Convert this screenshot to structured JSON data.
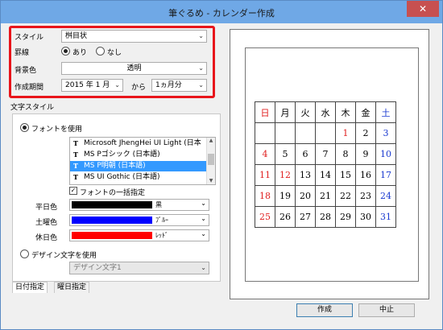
{
  "window": {
    "title": "筆ぐるめ - カレンダー作成",
    "close_symbol": "✕"
  },
  "settings": {
    "style_label": "スタイル",
    "style_value": "桝目状",
    "border_label": "罫線",
    "border_on": "あり",
    "border_off": "なし",
    "bg_label": "背景色",
    "bg_value": "透明",
    "period_label": "作成期間",
    "period_start": "2015 年 1 月",
    "period_connector": "から",
    "period_length": "1ヵ月分"
  },
  "text_style": {
    "section_title": "文字スタイル",
    "use_font_label": "フォントを使用",
    "fonts": [
      "Microsoft JhengHei UI Light (日本",
      "MS Pゴシック (日本語)",
      "MS P明朝 (日本語)",
      "MS UI Gothic (日本語)"
    ],
    "tt_symbol": "T",
    "bulk_label": "フォントの一括指定",
    "weekday_label": "平日色",
    "weekday_color_name": "黒",
    "weekday_color": "#000000",
    "saturday_label": "土曜色",
    "saturday_color_name": "ﾌﾞﾙｰ",
    "saturday_color": "#0000ff",
    "holiday_label": "休日色",
    "holiday_color_name": "ﾚｯﾄﾞ",
    "holiday_color": "#ff0000",
    "design_label": "デザイン文字を使用",
    "design_value": "デザイン文字1"
  },
  "tabs": [
    "日付指定",
    "曜日指定"
  ],
  "calendar": {
    "header": [
      "日",
      "月",
      "火",
      "水",
      "木",
      "金",
      "土"
    ],
    "rows": [
      [
        "",
        "",
        "",
        "",
        "1",
        "2",
        "3"
      ],
      [
        "4",
        "5",
        "6",
        "7",
        "8",
        "9",
        "10"
      ],
      [
        "11",
        "12",
        "13",
        "14",
        "15",
        "16",
        "17"
      ],
      [
        "18",
        "19",
        "20",
        "21",
        "22",
        "23",
        "24"
      ],
      [
        "25",
        "26",
        "27",
        "28",
        "29",
        "30",
        "31"
      ]
    ],
    "red_dates": [
      "1",
      "4",
      "11",
      "12",
      "18",
      "25"
    ]
  },
  "buttons": {
    "create": "作成",
    "cancel": "中止"
  },
  "colors": {
    "red_frame": "#e8151b",
    "holiday_red": "#e02020",
    "saturday_blue": "#1a3ad0",
    "selection": "#3399ff"
  }
}
